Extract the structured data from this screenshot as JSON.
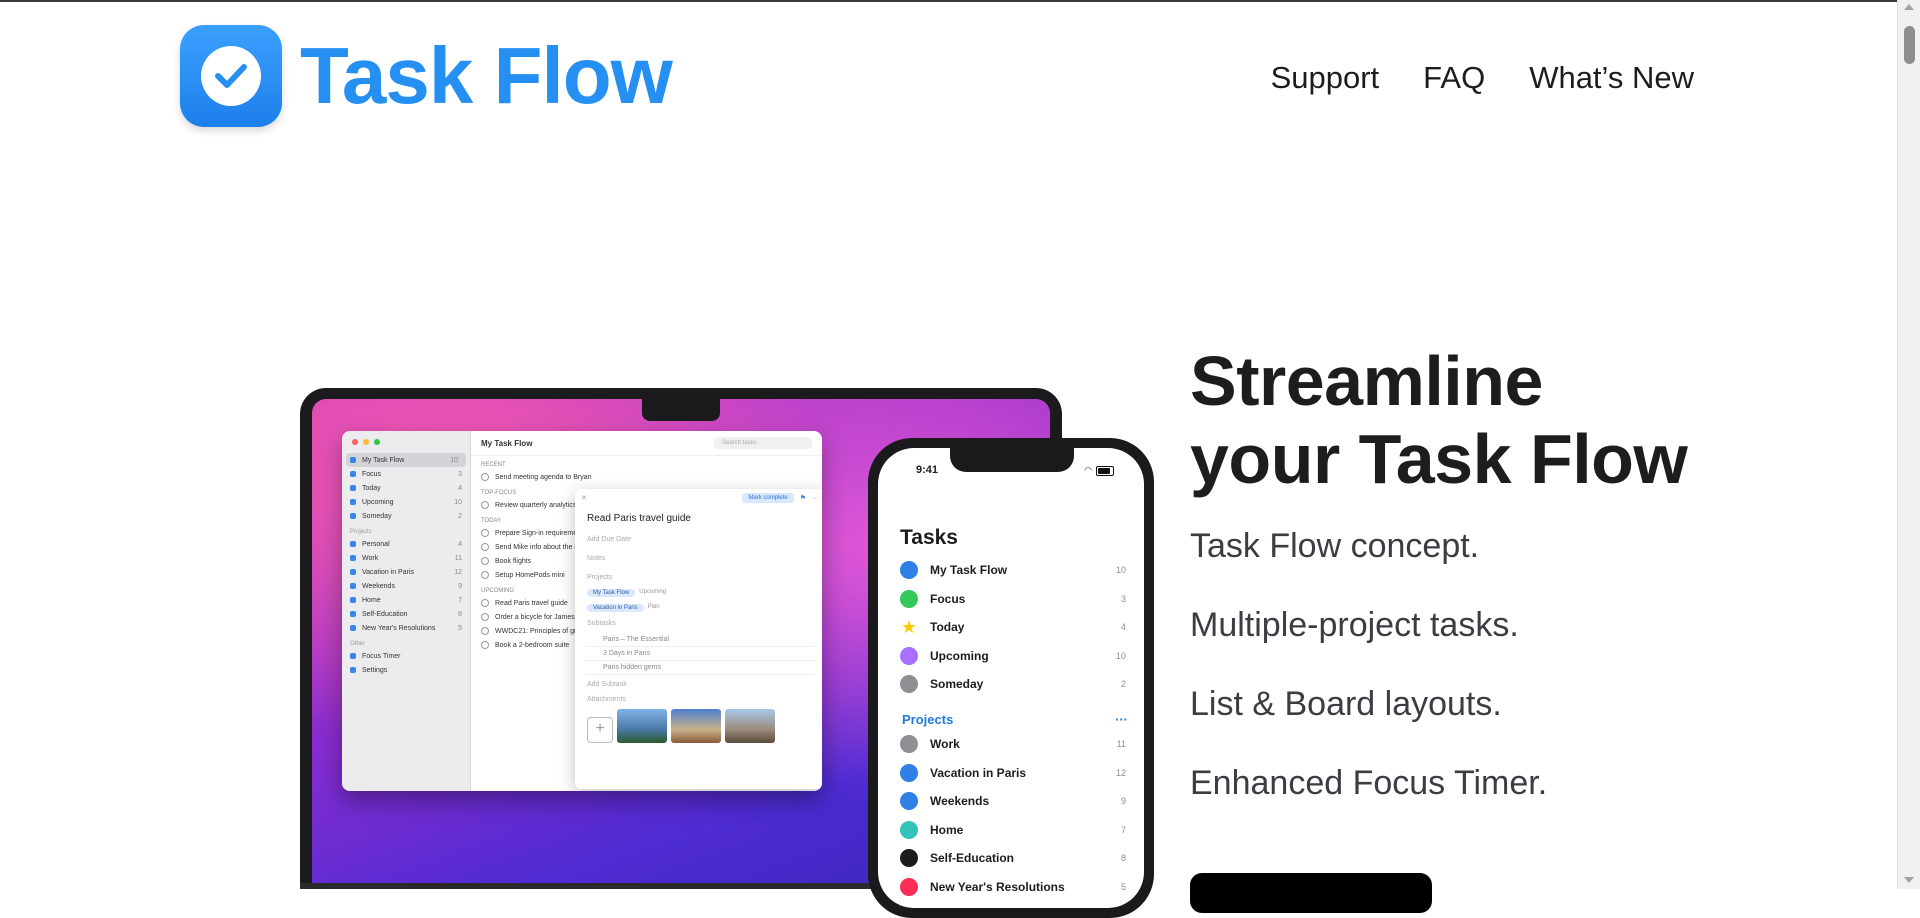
{
  "header": {
    "logo_text": "Task Flow",
    "nav": [
      "Support",
      "FAQ",
      "What’s New"
    ]
  },
  "hero": {
    "title_line1": "Streamline",
    "title_line2": "your Task Flow",
    "features": [
      "Task Flow concept.",
      "Multiple-project tasks.",
      "List & Board layouts.",
      "Enhanced Focus Timer."
    ]
  },
  "mac_app": {
    "window_title": "My Task Flow",
    "search_placeholder": "Search tasks",
    "sidebar_main": [
      {
        "label": "My Task Flow",
        "count": "10",
        "color": "#3a86e8"
      },
      {
        "label": "Focus",
        "count": "3",
        "color": "#3a86e8"
      },
      {
        "label": "Today",
        "count": "4",
        "color": "#3a86e8"
      },
      {
        "label": "Upcoming",
        "count": "10",
        "color": "#3a86e8"
      },
      {
        "label": "Someday",
        "count": "2",
        "color": "#3a86e8"
      }
    ],
    "projects_heading": "Projects",
    "sidebar_projects": [
      {
        "label": "Personal",
        "count": "4"
      },
      {
        "label": "Work",
        "count": "11"
      },
      {
        "label": "Vacation in Paris",
        "count": "12"
      },
      {
        "label": "Weekends",
        "count": "9"
      },
      {
        "label": "Home",
        "count": "7"
      },
      {
        "label": "Self-Education",
        "count": "8"
      },
      {
        "label": "New Year's Resolutions",
        "count": "5"
      }
    ],
    "other_heading": "Other",
    "sidebar_other": [
      "Focus Timer",
      "Settings"
    ],
    "sections": {
      "recent": "RECENT",
      "recent_tasks": [
        "Send meeting agenda to Bryan"
      ],
      "top_focus": "TOP-FOCUS",
      "top_focus_tasks": [
        "Review quarterly analytics"
      ],
      "today": "TODAY",
      "today_tasks": [
        "Prepare Sign-in requirements",
        "Send Mike info about the l",
        "Book flights",
        "Setup HomePods mini"
      ],
      "upcoming": "UPCOMING",
      "upcoming_tasks": [
        "Read Paris travel guide",
        "Order a bicycle for James",
        "WWDC21: Principles of gr",
        "Book a 2-bedroom suite"
      ]
    },
    "popup": {
      "mark_complete": "Mark complete",
      "title": "Read Paris travel guide",
      "add_due_date": "Add Due Date",
      "notes": "Notes",
      "projects": "Projects",
      "chip1": "My Task Flow",
      "chip1_status": "Upcoming",
      "chip2": "Vacation in Paris",
      "chip2_status": "Plan",
      "subtasks": "Subtasks",
      "subtask_items": [
        "Paris – The Essential",
        "3 Days in Paris",
        "Paris hidden gems"
      ],
      "add_subtask": "Add Subtask",
      "attachments": "Attachments"
    }
  },
  "phone_app": {
    "time": "9:41",
    "title": "Tasks",
    "items": [
      {
        "label": "My Task Flow",
        "count": "10",
        "color": "#2e7fe6",
        "icon": "inbox-icon"
      },
      {
        "label": "Focus",
        "count": "3",
        "color": "#34c759",
        "icon": "focus-icon"
      },
      {
        "label": "Today",
        "count": "4",
        "color": "#ffcc00",
        "icon": "star-icon"
      },
      {
        "label": "Upcoming",
        "count": "10",
        "color": "#a970ff",
        "icon": "calendar-icon"
      },
      {
        "label": "Someday",
        "count": "2",
        "color": "#8e8e93",
        "icon": "archive-icon"
      }
    ],
    "projects_heading": "Projects",
    "projects_more": "···",
    "projects": [
      {
        "label": "Work",
        "count": "11",
        "color": "#8e8e93",
        "icon": "briefcase-icon"
      },
      {
        "label": "Vacation in Paris",
        "count": "12",
        "color": "#2e7fe6",
        "icon": "plane-icon"
      },
      {
        "label": "Weekends",
        "count": "9",
        "color": "#2e7fe6",
        "icon": "thumbs-up-icon"
      },
      {
        "label": "Home",
        "count": "7",
        "color": "#34c3b8",
        "icon": "home-icon"
      },
      {
        "label": "Self-Education",
        "count": "8",
        "color": "#1c1c1e",
        "icon": "graduation-icon"
      },
      {
        "label": "New Year's Resolutions",
        "count": "5",
        "color": "#ff2d55",
        "icon": "flag-icon"
      }
    ]
  }
}
